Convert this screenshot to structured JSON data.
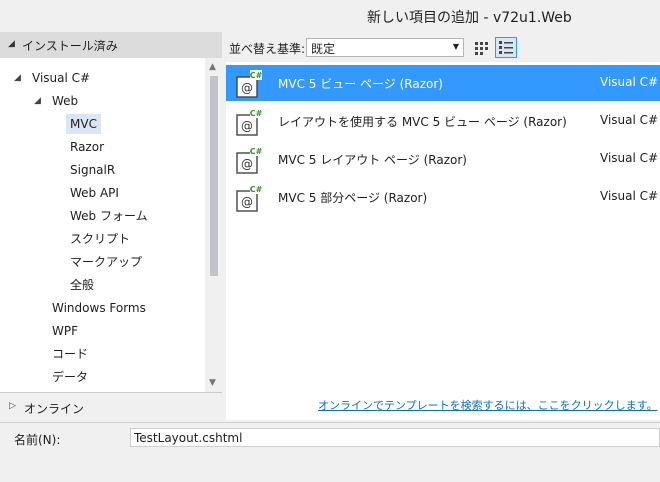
{
  "window": {
    "title": "新しい項目の追加 - v72u1.Web"
  },
  "left_pane": {
    "installed_label": "インストール済み",
    "online_label": "オンライン",
    "tree": [
      {
        "label": "Visual C#"
      },
      {
        "label": "Web"
      },
      {
        "label": "MVC"
      },
      {
        "label": "Razor"
      },
      {
        "label": "SignalR"
      },
      {
        "label": "Web API"
      },
      {
        "label": "Web フォーム"
      },
      {
        "label": "スクリプト"
      },
      {
        "label": "マークアップ"
      },
      {
        "label": "全般"
      },
      {
        "label": "Windows Forms"
      },
      {
        "label": "WPF"
      },
      {
        "label": "コード"
      },
      {
        "label": "データ"
      }
    ]
  },
  "toolbar": {
    "sort_label": "並べ替え基準:",
    "sort_value": "既定"
  },
  "templates": [
    {
      "name": "MVC 5 ビュー ページ (Razor)",
      "lang": "Visual C#"
    },
    {
      "name": "レイアウトを使用する MVC 5 ビュー ページ (Razor)",
      "lang": "Visual C#"
    },
    {
      "name": "MVC 5 レイアウト ページ (Razor)",
      "lang": "Visual C#"
    },
    {
      "name": "MVC 5 部分ページ (Razor)",
      "lang": "Visual C#"
    }
  ],
  "online_templates_link": "オンラインでテンプレートを検索するには、ここをクリックします。",
  "name_field": {
    "label": "名前(N):",
    "value": "TestLayout.cshtml"
  },
  "colors": {
    "selection": "#3399ff",
    "link": "#0e70c0",
    "tree_selection": "#dbe6f4"
  }
}
